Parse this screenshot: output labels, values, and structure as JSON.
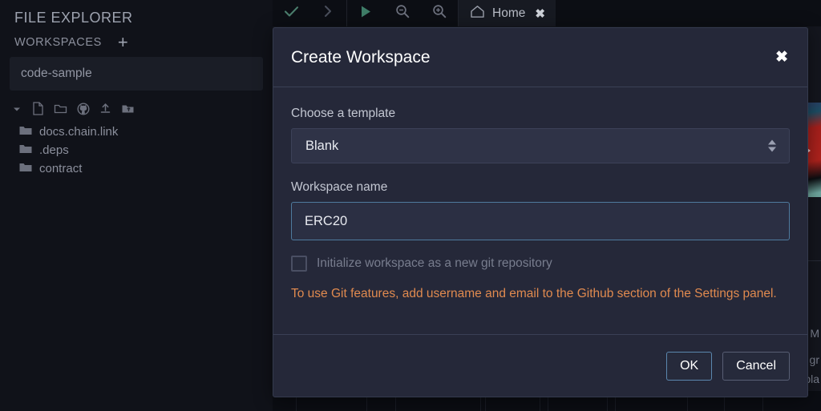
{
  "sidebar": {
    "title": "FILE EXPLORER",
    "workspaces_label": "WORKSPACES",
    "add_workspace_icon": "plus-icon",
    "selected_workspace": "code-sample",
    "tree_toolbar": [
      {
        "icon": "caret-down-icon",
        "name": "collapse-toggle"
      },
      {
        "icon": "new-file-icon",
        "name": "new-file"
      },
      {
        "icon": "new-folder-icon",
        "name": "new-folder"
      },
      {
        "icon": "github-icon",
        "name": "clone-from-github"
      },
      {
        "icon": "upload-file-icon",
        "name": "upload-file"
      },
      {
        "icon": "upload-folder-icon",
        "name": "upload-folder"
      }
    ],
    "tree_items": [
      {
        "label": "docs.chain.link",
        "icon": "folder-icon"
      },
      {
        "label": ".deps",
        "icon": "folder-icon"
      },
      {
        "label": "contract",
        "icon": "folder-icon"
      }
    ]
  },
  "toolbar": {
    "buttons": [
      {
        "name": "check-button",
        "icon": "check-icon",
        "color": "#4c7f6e"
      },
      {
        "name": "step-forward-button",
        "icon": "chevron-right-icon",
        "color": "#4a4f5c"
      },
      {
        "name": "run-button",
        "icon": "play-icon",
        "color": "#3f7d68"
      },
      {
        "name": "zoom-out-button",
        "icon": "zoom-out-icon",
        "color": "#6d717e"
      },
      {
        "name": "zoom-in-button",
        "icon": "zoom-in-icon",
        "color": "#6d717e"
      }
    ],
    "tab": {
      "label": "Home",
      "icon": "home-icon",
      "close_icon": "close-icon"
    }
  },
  "background": {
    "snippets": [
      "M",
      "gr",
      "bla"
    ]
  },
  "modal": {
    "title": "Create Workspace",
    "close_icon": "close-icon",
    "template_label": "Choose a template",
    "template_value": "Blank",
    "name_label": "Workspace name",
    "name_value": "ERC20",
    "name_placeholder": "",
    "git_checkbox_label": "Initialize workspace as a new git repository",
    "git_checkbox_checked": false,
    "git_checkbox_disabled": true,
    "warning": "To use Git features, add username and email to the Github section of the Settings panel.",
    "warning_color": "#e08a4f",
    "ok_label": "OK",
    "cancel_label": "Cancel",
    "accent_color": "#5b87ae"
  }
}
